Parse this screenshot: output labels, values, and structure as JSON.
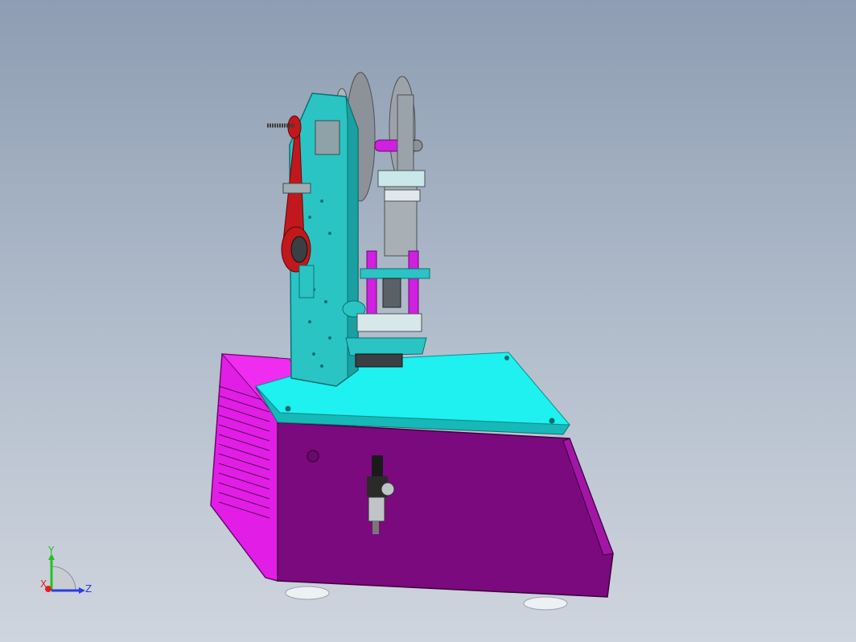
{
  "viewport": {
    "background_top": "#8e9db3",
    "background_bottom": "#cfd5de"
  },
  "model": {
    "colors": {
      "housing": "#7b0a7e",
      "housing_light": "#e21ee6",
      "plate": "#1ff0f0",
      "frame": "#2bc4c4",
      "belt": "#c0181c",
      "rod": "#d020e0",
      "cylinder": "#9aa3aa",
      "disc": "#8d9298",
      "foot": "#e8ecf0"
    }
  },
  "triad": {
    "y_label": "Y",
    "x_label": "X",
    "z_label": "Z",
    "y_color": "#22c222",
    "x_color": "#e02020",
    "z_color": "#2a3ee0"
  }
}
